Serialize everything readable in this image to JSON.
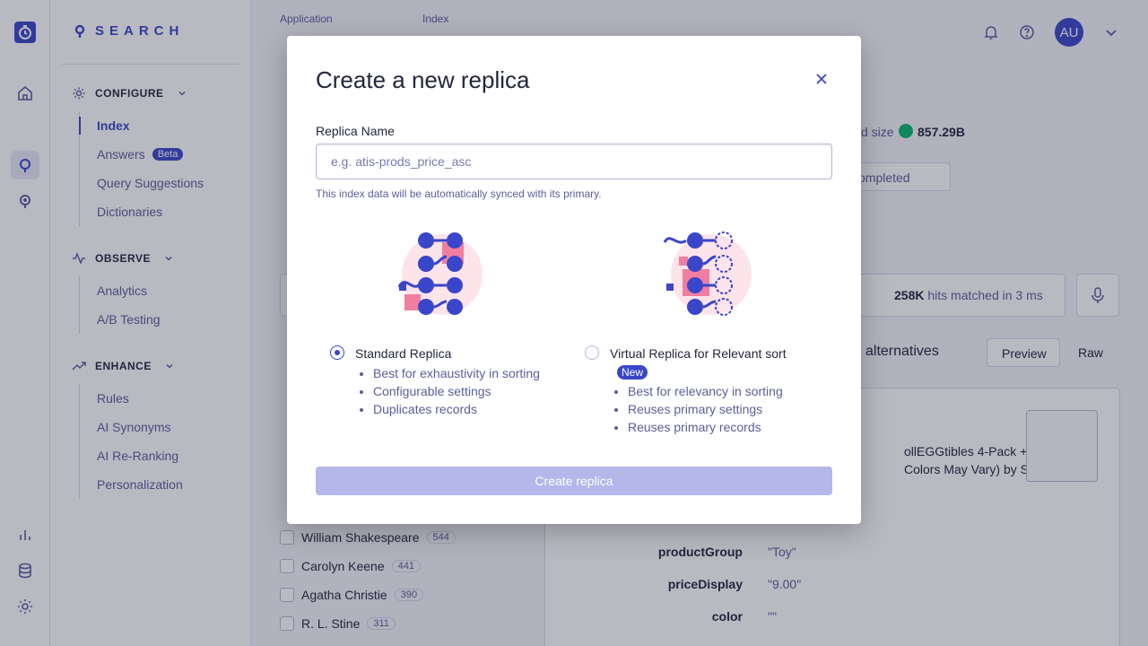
{
  "sidebar": {
    "brand": "SEARCH",
    "sections": [
      {
        "title": "CONFIGURE",
        "items": [
          {
            "label": "Index",
            "active": true
          },
          {
            "label": "Answers",
            "badge": "Beta"
          },
          {
            "label": "Query Suggestions"
          },
          {
            "label": "Dictionaries"
          }
        ]
      },
      {
        "title": "OBSERVE",
        "items": [
          {
            "label": "Analytics"
          },
          {
            "label": "A/B Testing"
          }
        ]
      },
      {
        "title": "ENHANCE",
        "items": [
          {
            "label": "Rules"
          },
          {
            "label": "AI Synonyms"
          },
          {
            "label": "AI Re-Ranking"
          },
          {
            "label": "Personalization"
          }
        ]
      }
    ]
  },
  "header": {
    "application_label": "Application",
    "index_label": "Index",
    "avatar_initials": "AU"
  },
  "background": {
    "size_label": "d size",
    "size_value": "857.29B",
    "completed_label": "ompleted",
    "hits_count": "258K",
    "hits_text": "hits matched in 3 ms",
    "alternatives_label": "alternatives",
    "preview_tab": "Preview",
    "raw_tab": "Raw",
    "product_text_1": "ollEGGtibles 4-Pack +",
    "product_text_2": "Colors May Vary) by Spin",
    "attributes": [
      {
        "key": "productGroup",
        "value": "\"Toy\""
      },
      {
        "key": "priceDisplay",
        "value": "\"9.00\""
      },
      {
        "key": "color",
        "value": "\"\""
      }
    ],
    "facets": [
      {
        "label": "William Shakespeare",
        "count": "544"
      },
      {
        "label": "Carolyn Keene",
        "count": "441"
      },
      {
        "label": "Agatha Christie",
        "count": "390"
      },
      {
        "label": "R. L. Stine",
        "count": "311"
      }
    ]
  },
  "modal": {
    "title": "Create a new replica",
    "field_label": "Replica Name",
    "field_placeholder": "e.g. atis-prods_price_asc",
    "field_value": "",
    "help_text": "This index data will be automatically synced with its primary.",
    "options": [
      {
        "label": "Standard Replica",
        "selected": true,
        "bullets": [
          "Best for exhaustivity in sorting",
          "Configurable settings",
          "Duplicates records"
        ]
      },
      {
        "label": "Virtual Replica for Relevant sort",
        "selected": false,
        "badge": "New",
        "bullets": [
          "Best for relevancy in sorting",
          "Reuses primary settings",
          "Reuses primary records"
        ]
      }
    ],
    "submit_label": "Create replica",
    "submit_enabled": false
  },
  "colors": {
    "primary": "#3a46c9",
    "text": "#23263b",
    "muted": "#5a5e9a",
    "disabled_button": "#b3b7ea",
    "accent_pink": "#f07ea0"
  }
}
